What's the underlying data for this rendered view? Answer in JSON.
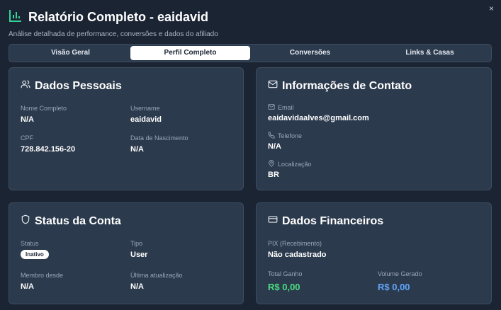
{
  "header": {
    "title": "Relatório Completo - eaidavid",
    "subtitle": "Análise detalhada de performance, conversões e dados do afiliado",
    "close": "×"
  },
  "tabs": [
    "Visão Geral",
    "Perfil Completo",
    "Conversões",
    "Links & Casas"
  ],
  "active_tab": "Perfil Completo",
  "personal": {
    "title": "Dados Pessoais",
    "full_name_label": "Nome Completo",
    "full_name": "N/A",
    "username_label": "Username",
    "username": "eaidavid",
    "cpf_label": "CPF",
    "cpf": "728.842.156-20",
    "birth_label": "Data de Nascimento",
    "birth": "N/A"
  },
  "contact": {
    "title": "Informações de Contato",
    "email_label": "Email",
    "email": "eaidavidaalves@gmail.com",
    "phone_label": "Telefone",
    "phone": "N/A",
    "location_label": "Localização",
    "location": "BR"
  },
  "account": {
    "title": "Status da Conta",
    "status_label": "Status",
    "status": "Inativo",
    "type_label": "Tipo",
    "type": "User",
    "member_label": "Membro desde",
    "member": "N/A",
    "updated_label": "Última atualização",
    "updated": "N/A"
  },
  "financial": {
    "title": "Dados Financeiros",
    "pix_label": "PIX (Recebimento)",
    "pix": "Não cadastrado",
    "earned_label": "Total Ganho",
    "earned": "R$ 0,00",
    "volume_label": "Volume Gerado",
    "volume": "R$ 0,00"
  },
  "colors": {
    "accent_green": "#4ade80",
    "accent_blue": "#60a5fa",
    "chart_icon": "#34d399"
  }
}
